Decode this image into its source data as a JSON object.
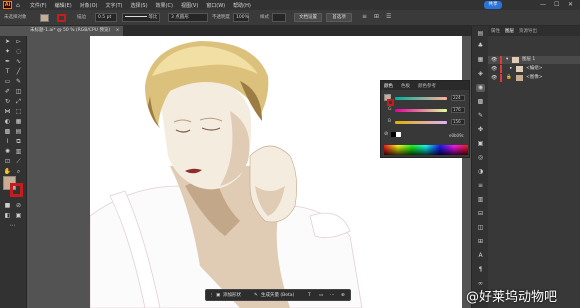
{
  "app": {
    "logo": "Ai"
  },
  "menu": [
    "文件(F)",
    "编辑(E)",
    "对象(O)",
    "文字(T)",
    "选择(S)",
    "效果(C)",
    "视图(V)",
    "窗口(W)",
    "帮助(H)"
  ],
  "share_label": "共享",
  "window_controls": [
    "—",
    "☐",
    "✕"
  ],
  "control": {
    "selection_label": "未选择对象",
    "stroke_label": "描边",
    "stroke_value": "0.5 pt",
    "line_label": "等比",
    "brush_label": "3 点圆形",
    "opacity_label": "不透明度",
    "opacity_value": "100%",
    "style_label": "样式",
    "doc_settings": "文档设置",
    "preferences": "首选项"
  },
  "tab": {
    "title": "未标题-1.ai* @ 50 % (RGB/CPU 预览)"
  },
  "colors": {
    "fill": "#c7ad93",
    "stroke": "#c51d1d",
    "hair_light": "#f1dfa3",
    "hair_mid": "#dcc17c",
    "hair_dark": "#9d7c44",
    "skin_light": "#f4ecdf",
    "skin_mid": "#e0cbb4",
    "skin_shadow": "#c3a789",
    "lip": "#8e2c2e",
    "dress": "#fbfbfb"
  },
  "color_panel": {
    "tabs": [
      "颜色",
      "色板",
      "颜色参考"
    ],
    "channels": [
      {
        "label": "R",
        "value": "224"
      },
      {
        "label": "G",
        "value": "176"
      },
      {
        "label": "B",
        "value": "156"
      }
    ],
    "hex": "e0b09c"
  },
  "layers_panel": {
    "tabs": [
      "属性",
      "图层",
      "资源导出"
    ],
    "rows": [
      {
        "name": "图层 1"
      },
      {
        "name": "<编组>"
      },
      {
        "name": "<图像>"
      }
    ]
  },
  "context_bar": {
    "buttons": [
      "添加形状",
      "生成矢量 (Beta)"
    ]
  },
  "watermark": "@好莱坞动物吧"
}
